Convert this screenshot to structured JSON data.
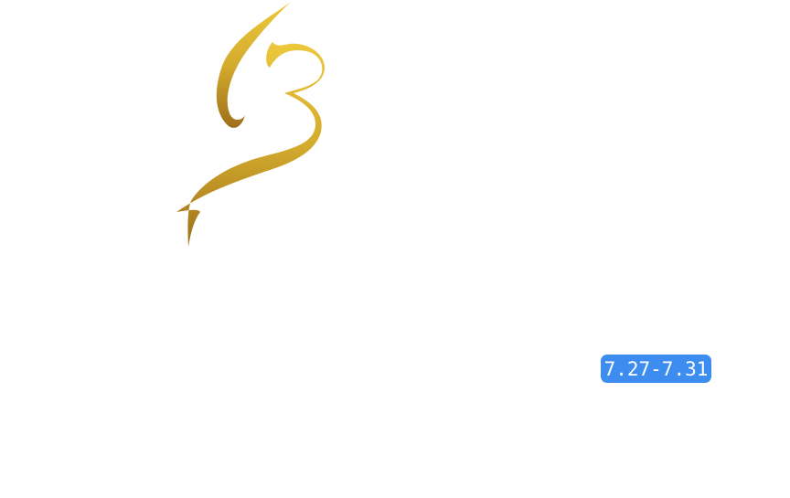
{
  "logo": {
    "icon": "gold-brush-stroke-13-icon",
    "color_light": "#e6c23a",
    "color_dark": "#a9781f"
  },
  "date_badge": {
    "text": "7.27-7.31",
    "background": "#3d8df0",
    "text_color": "#ffffff"
  }
}
